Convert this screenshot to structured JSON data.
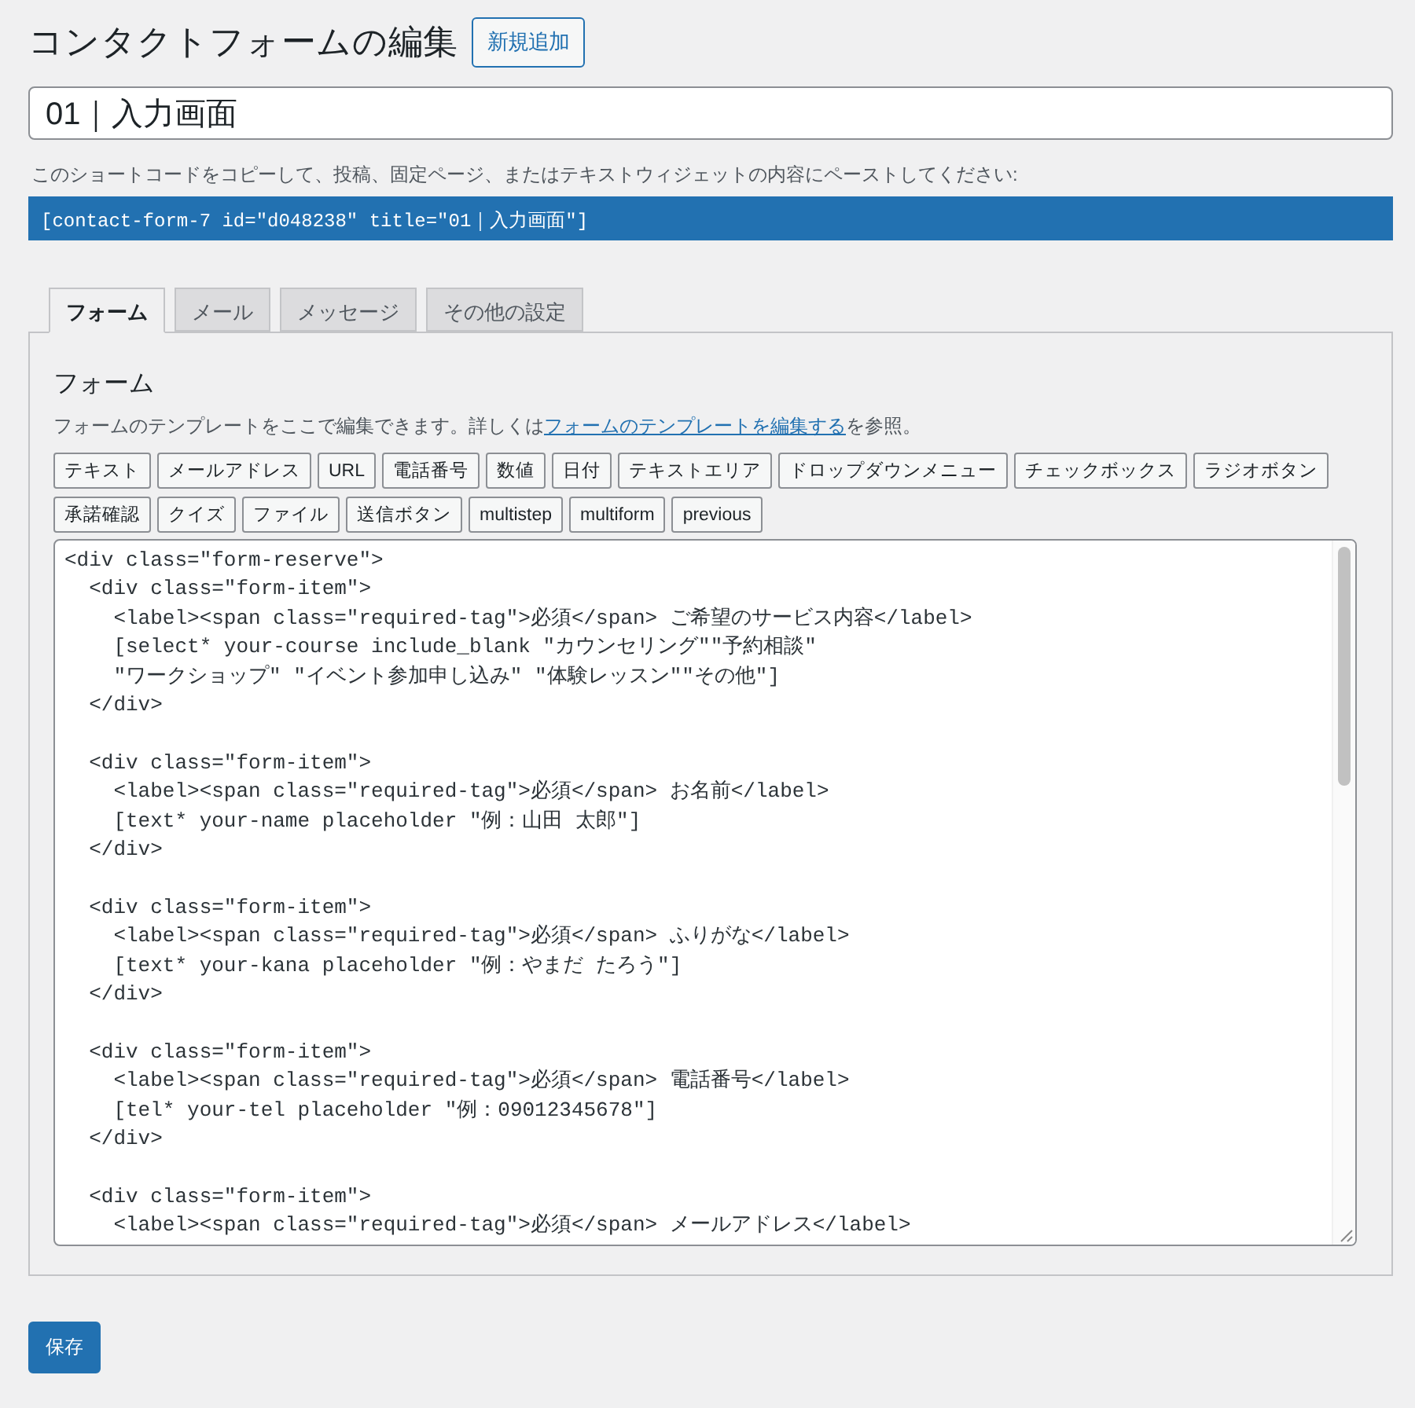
{
  "page": {
    "title": "コンタクトフォームの編集",
    "add_new_button": "新規追加"
  },
  "form_title": {
    "value": "01｜入力画面"
  },
  "shortcode": {
    "hint": "このショートコードをコピーして、投稿、固定ページ、またはテキストウィジェットの内容にペーストしてください:",
    "code": "[contact-form-7 id=\"d048238\" title=\"01｜入力画面\"]"
  },
  "tabs": [
    {
      "label": "フォーム",
      "selected": true
    },
    {
      "label": "メール",
      "selected": false
    },
    {
      "label": "メッセージ",
      "selected": false
    },
    {
      "label": "その他の設定",
      "selected": false
    }
  ],
  "panel": {
    "heading": "フォーム",
    "description": {
      "before": "フォームのテンプレートをここで編集できます。詳しくは",
      "link": "フォームのテンプレートを編集する",
      "after": "を参照。"
    },
    "tag_buttons": [
      "テキスト",
      "メールアドレス",
      "URL",
      "電話番号",
      "数値",
      "日付",
      "テキストエリア",
      "ドロップダウンメニュー",
      "チェックボックス",
      "ラジオボタン",
      "承諾確認",
      "クイズ",
      "ファイル",
      "送信ボタン",
      "multistep",
      "multiform",
      "previous"
    ],
    "code": "<div class=\"form-reserve\">\n  <div class=\"form-item\">\n    <label><span class=\"required-tag\">必須</span> ご希望のサービス内容</label>\n    [select* your-course include_blank \"カウンセリング\"\"予約相談\"\n    \"ワークショップ\" \"イベント参加申し込み\" \"体験レッスン\"\"その他\"]\n  </div>\n\n  <div class=\"form-item\">\n    <label><span class=\"required-tag\">必須</span> お名前</label>\n    [text* your-name placeholder \"例：山田 太郎\"]\n  </div>\n\n  <div class=\"form-item\">\n    <label><span class=\"required-tag\">必須</span> ふりがな</label>\n    [text* your-kana placeholder \"例：やまだ たろう\"]\n  </div>\n\n  <div class=\"form-item\">\n    <label><span class=\"required-tag\">必須</span> 電話番号</label>\n    [tel* your-tel placeholder \"例：09012345678\"]\n  </div>\n\n  <div class=\"form-item\">\n    <label><span class=\"required-tag\">必須</span> メールアドレス</label>"
  },
  "save_button": "保存"
}
